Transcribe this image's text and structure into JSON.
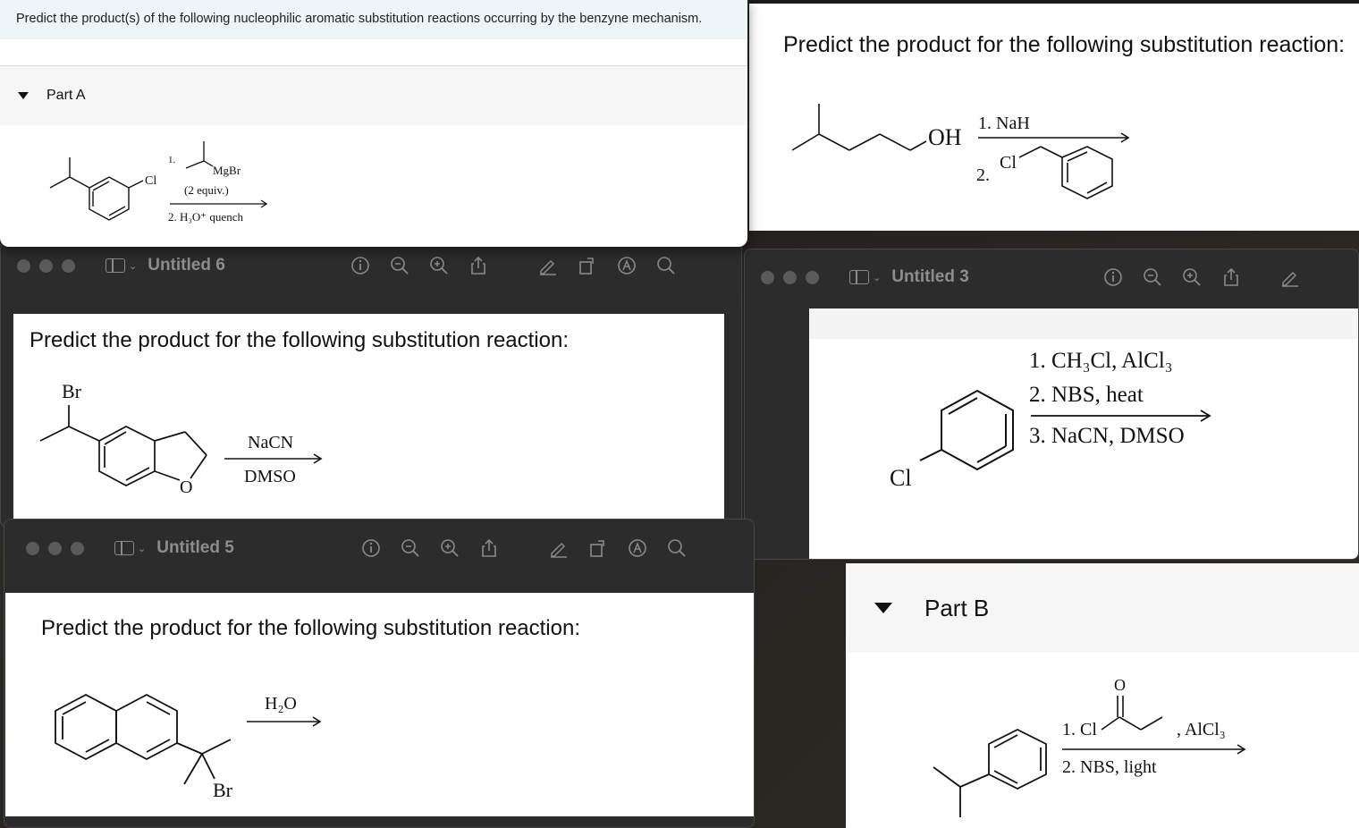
{
  "question_a": {
    "prompt": "Predict the product(s) of the following nucleophilic aromatic substitution reactions occurring by the benzyne mechanism.",
    "part_label": "Part A",
    "reagents": {
      "step1_num": "1.",
      "grignard": "MgBr",
      "equiv": "(2 equiv.)",
      "step2": "2. H₃O⁺ quench",
      "leaving": "Cl"
    }
  },
  "right_top": {
    "title": "Predict the product for the following substitution reaction:",
    "oh": "OH",
    "step1": "1. NaH",
    "step2_num": "2.",
    "cl": "Cl"
  },
  "untitled6": {
    "doc_title": "Untitled 6",
    "title": "Predict the product for the following substitution reaction:",
    "br": "Br",
    "o": "O",
    "reagent_top": "NaCN",
    "reagent_bottom": "DMSO"
  },
  "untitled5": {
    "doc_title": "Untitled 5",
    "title": "Predict the product for the following substitution reaction:",
    "reagent_top": "H₂O",
    "br": "Br"
  },
  "untitled3": {
    "doc_title": "Untitled 3",
    "cl": "Cl",
    "step1": "1. CH₃Cl, AlCl₃",
    "step2": "2. NBS, heat",
    "step3": "3. NaCN, DMSO"
  },
  "part_b": {
    "part_label": "Part B",
    "o": "O",
    "step1": "1. Cl",
    "catalyst": ", AlCl₃",
    "step2": "2. NBS, light"
  },
  "icons": [
    "info-icon",
    "zoom-out-icon",
    "zoom-in-icon",
    "share-icon",
    "markup-pen-icon",
    "rotate-icon",
    "annotate-icon",
    "search-icon"
  ],
  "colors": {
    "header_bg": "#ecf5f7",
    "toolbar_bg": "#2c2c2c",
    "toolbar_text": "#8d8d8d"
  }
}
